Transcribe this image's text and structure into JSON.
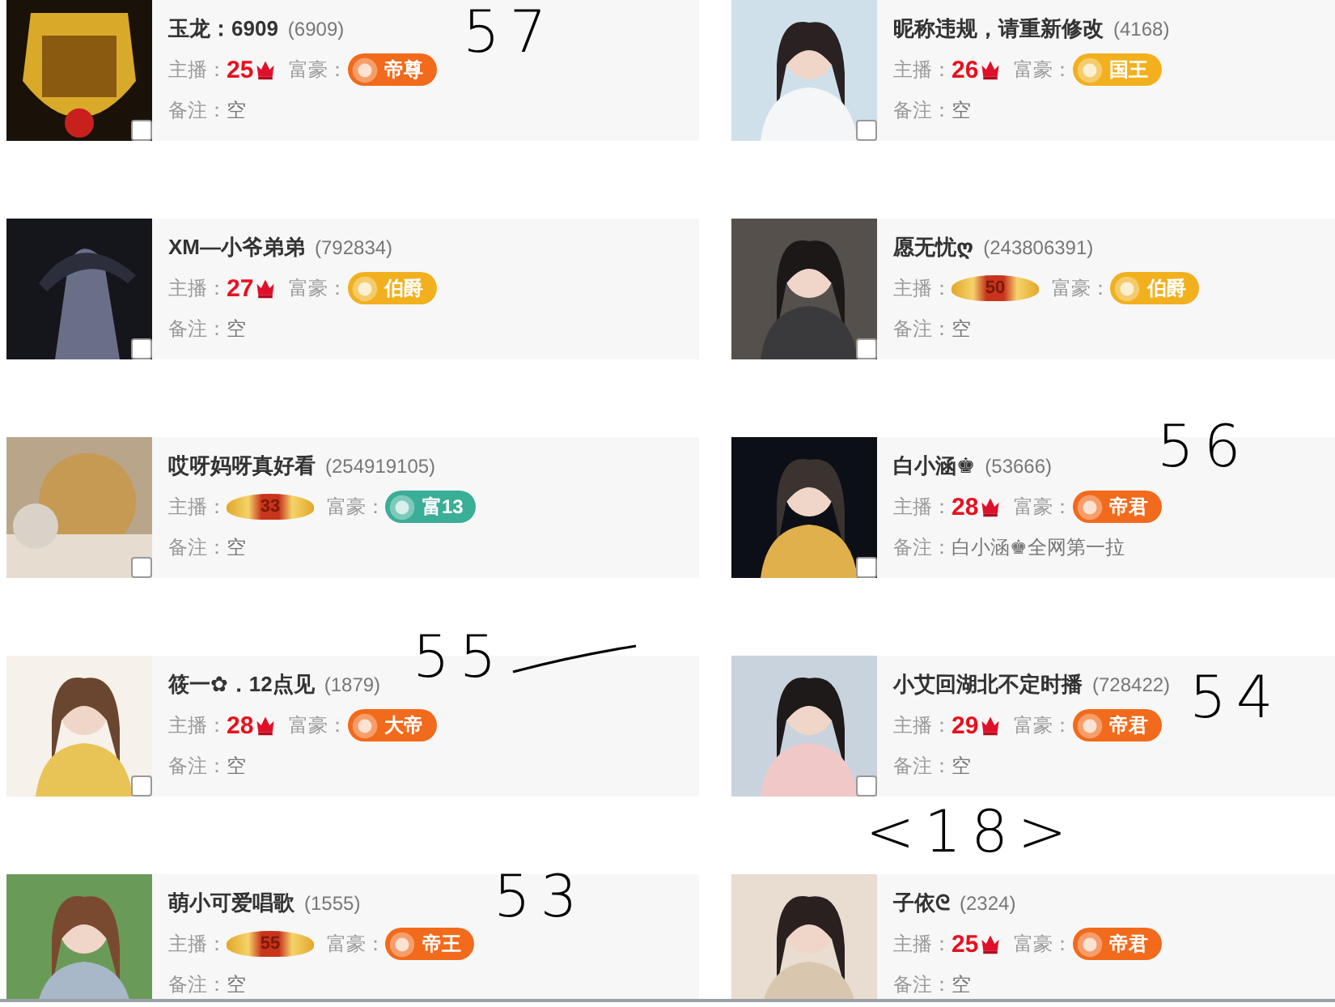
{
  "cards": [
    {
      "name": "玉龙：6909",
      "id": "(6909)",
      "anchor_label": "主播：",
      "anchor": {
        "kind": "number",
        "value": "25"
      },
      "rich_label": "富豪：",
      "rich": {
        "label": "帝尊",
        "color": "#f26a1b"
      },
      "note_label": "备注：",
      "note": "空",
      "checked": false,
      "annotation": "57"
    },
    {
      "name": "昵称违规，请重新修改",
      "id": "(4168)",
      "anchor_label": "主播：",
      "anchor": {
        "kind": "number",
        "value": "26"
      },
      "rich_label": "富豪：",
      "rich": {
        "label": "国王",
        "color": "#f2b01e"
      },
      "note_label": "备注：",
      "note": "空",
      "checked": false
    },
    {
      "name": "XM—小爷弟弟",
      "id": "(792834)",
      "anchor_label": "主播：",
      "anchor": {
        "kind": "number",
        "value": "27"
      },
      "rich_label": "富豪：",
      "rich": {
        "label": "伯爵",
        "color": "#f2b01e"
      },
      "note_label": "备注：",
      "note": "空",
      "checked": false
    },
    {
      "name": "愿无忧ღ",
      "id": "(243806391)",
      "anchor_label": "主播：",
      "anchor": {
        "kind": "badge",
        "value": "50"
      },
      "rich_label": "富豪：",
      "rich": {
        "label": "伯爵",
        "color": "#f2b01e"
      },
      "note_label": "备注：",
      "note": "空",
      "checked": false
    },
    {
      "name": "哎呀妈呀真好看",
      "id": "(254919105)",
      "anchor_label": "主播：",
      "anchor": {
        "kind": "badge",
        "value": "33"
      },
      "rich_label": "富豪：",
      "rich": {
        "label": "富13",
        "color": "#3aae96"
      },
      "note_label": "备注：",
      "note": "空",
      "checked": false
    },
    {
      "name": "白小涵♚",
      "id": "(53666)",
      "anchor_label": "主播：",
      "anchor": {
        "kind": "number",
        "value": "28"
      },
      "rich_label": "富豪：",
      "rich": {
        "label": "帝君",
        "color": "#f26a1b"
      },
      "note_label": "备注：",
      "note": "白小涵♚全网第一拉",
      "checked": false,
      "annotation": "56"
    },
    {
      "name": "筱一✿．12点见",
      "id": "(1879)",
      "anchor_label": "主播：",
      "anchor": {
        "kind": "number",
        "value": "28"
      },
      "rich_label": "富豪：",
      "rich": {
        "label": "大帝",
        "color": "#f26a1b"
      },
      "note_label": "备注：",
      "note": "空",
      "checked": false,
      "annotation": "55",
      "annotation_line": true
    },
    {
      "name": "小艾回湖北不定时播",
      "id": "(728422)",
      "anchor_label": "主播：",
      "anchor": {
        "kind": "number",
        "value": "29"
      },
      "rich_label": "富豪：",
      "rich": {
        "label": "帝君",
        "color": "#f26a1b"
      },
      "note_label": "备注：",
      "note": "空",
      "checked": false,
      "annotation": "54"
    },
    {
      "name": "萌小可爱唱歌",
      "id": "(1555)",
      "anchor_label": "主播：",
      "anchor": {
        "kind": "badge",
        "value": "55"
      },
      "rich_label": "富豪：",
      "rich": {
        "label": "帝王",
        "color": "#f26a1b"
      },
      "note_label": "备注：",
      "note": "空",
      "annotation": "53"
    },
    {
      "name": "子依ᘓ",
      "id": "(2324)",
      "anchor_label": "主播：",
      "anchor": {
        "kind": "number",
        "value": "25"
      },
      "rich_label": "富豪：",
      "rich": {
        "label": "帝君",
        "color": "#f26a1b"
      },
      "note_label": "备注：",
      "note": "空",
      "annotation": "<18>"
    }
  ]
}
